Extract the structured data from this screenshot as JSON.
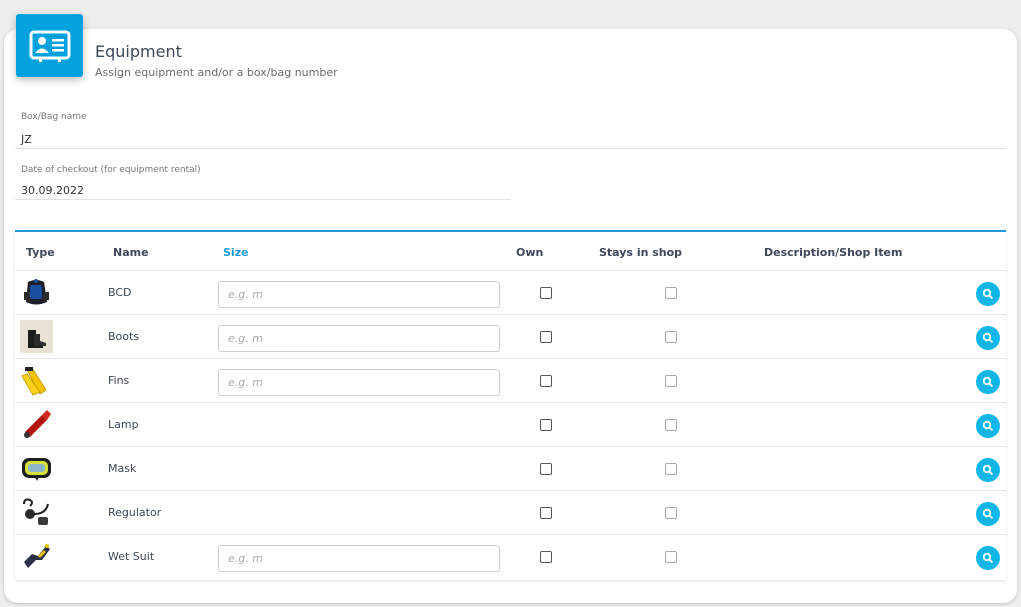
{
  "header": {
    "title": "Equipment",
    "subtitle": "Assign equipment and/or a box/bag number",
    "icon": "contact-card-icon",
    "accent": "#03a2de"
  },
  "form": {
    "box_bag": {
      "label": "Box/Bag name",
      "value": "JZ"
    },
    "checkout": {
      "label": "Date of checkout (for equipment rental)",
      "value": "30.09.2022"
    }
  },
  "table": {
    "columns": {
      "type": "Type",
      "name": "Name",
      "size": "Size",
      "own": "Own",
      "stays": "Stays in shop",
      "description": "Description/Shop Item"
    },
    "size_placeholder": "e.g. m",
    "rows": [
      {
        "name": "BCD",
        "icon": "bcd-icon",
        "has_size": true,
        "own": false,
        "stays": false
      },
      {
        "name": "Boots",
        "icon": "boots-icon",
        "has_size": true,
        "own": false,
        "stays": false
      },
      {
        "name": "Fins",
        "icon": "fins-icon",
        "has_size": true,
        "own": false,
        "stays": false
      },
      {
        "name": "Lamp",
        "icon": "lamp-icon",
        "has_size": false,
        "own": false,
        "stays": false
      },
      {
        "name": "Mask",
        "icon": "mask-icon",
        "has_size": false,
        "own": false,
        "stays": false
      },
      {
        "name": "Regulator",
        "icon": "regulator-icon",
        "has_size": false,
        "own": false,
        "stays": false
      },
      {
        "name": "Wet Suit",
        "icon": "wet-suit-icon",
        "has_size": true,
        "own": false,
        "stays": false
      }
    ],
    "accent": "#1d9ad9",
    "search_color": "#11b6e8"
  }
}
